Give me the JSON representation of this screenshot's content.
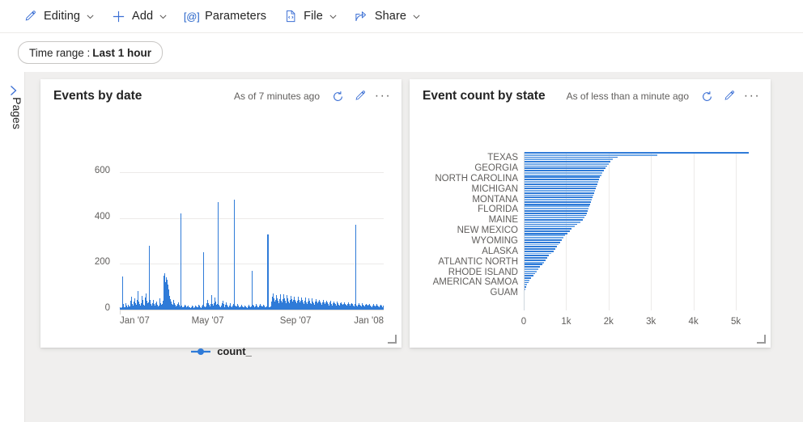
{
  "toolbar": {
    "items": [
      {
        "label": "Editing",
        "icon": "pencil-icon",
        "chevron": true
      },
      {
        "label": "Add",
        "icon": "plus-icon",
        "chevron": true
      },
      {
        "label": "Parameters",
        "icon": "at-bracket-icon",
        "chevron": false
      },
      {
        "label": "File",
        "icon": "code-file-icon",
        "chevron": true
      },
      {
        "label": "Share",
        "icon": "share-icon",
        "chevron": true
      }
    ]
  },
  "filters": {
    "time_range_prefix": "Time range : ",
    "time_range_value": "Last 1 hour"
  },
  "rail": {
    "label": "Pages",
    "expand_icon": "chevron-right-icon"
  },
  "cards": [
    {
      "title": "Events by date",
      "as_of": "As of 7 minutes ago",
      "refresh_icon": "refresh-icon",
      "edit_icon": "pencil-icon",
      "more_icon": "ellipsis-icon"
    },
    {
      "title": "Event count by state",
      "as_of": "As of less than a minute ago",
      "refresh_icon": "refresh-icon",
      "edit_icon": "pencil-icon",
      "more_icon": "ellipsis-icon"
    }
  ],
  "chart_data": [
    {
      "type": "bar",
      "title": "Events by date",
      "xlabel": "",
      "ylabel": "",
      "ylim": [
        0,
        660
      ],
      "yticks": [
        0,
        200,
        400,
        600
      ],
      "ytick_labels": [
        "0",
        "200",
        "400",
        "600"
      ],
      "xtick_labels": [
        "Jan '07",
        "May '07",
        "Sep '07",
        "Jan '08"
      ],
      "xtick_positions": [
        0,
        0.333,
        0.666,
        1.0
      ],
      "grid": "horizontal",
      "legend": [
        "count_"
      ],
      "legend_position": "bottom",
      "series_color": "#2f7bd8",
      "x": "date (daily, Jan 2007 - Jan 2008)",
      "values": [
        12,
        8,
        10,
        145,
        24,
        18,
        12,
        9,
        30,
        16,
        11,
        22,
        14,
        9,
        13,
        40,
        55,
        26,
        18,
        34,
        48,
        30,
        22,
        17,
        44,
        80,
        36,
        25,
        19,
        28,
        60,
        42,
        30,
        20,
        16,
        52,
        70,
        38,
        27,
        21,
        33,
        280,
        44,
        26,
        18,
        30,
        41,
        24,
        16,
        12,
        27,
        36,
        22,
        14,
        19,
        48,
        30,
        21,
        13,
        25,
        38,
        150,
        160,
        120,
        140,
        130,
        110,
        100,
        90,
        60,
        45,
        34,
        26,
        20,
        28,
        42,
        30,
        22,
        15,
        18,
        24,
        33,
        20,
        14,
        11,
        420,
        18,
        12,
        9,
        14,
        21,
        16,
        10,
        8,
        13,
        19,
        12,
        9,
        7,
        11,
        17,
        13,
        10,
        8,
        12,
        18,
        14,
        10,
        9,
        15,
        22,
        16,
        11,
        8,
        13,
        20,
        250,
        15,
        11,
        9,
        14,
        30,
        44,
        28,
        20,
        15,
        24,
        62,
        38,
        26,
        18,
        30,
        52,
        34,
        22,
        16,
        26,
        470,
        20,
        14,
        10,
        16,
        28,
        40,
        24,
        17,
        12,
        20,
        32,
        22,
        15,
        11,
        18,
        27,
        19,
        13,
        10,
        16,
        24,
        480,
        18,
        13,
        10,
        15,
        23,
        17,
        12,
        9,
        14,
        21,
        15,
        11,
        8,
        12,
        19,
        14,
        10,
        8,
        13,
        20,
        15,
        11,
        9,
        14,
        170,
        22,
        16,
        12,
        9,
        15,
        23,
        17,
        12,
        10,
        16,
        24,
        18,
        13,
        10,
        15,
        22,
        16,
        12,
        9,
        14,
        21,
        330,
        17,
        12,
        9,
        15,
        34,
        56,
        70,
        48,
        36,
        28,
        44,
        64,
        50,
        38,
        30,
        46,
        68,
        52,
        40,
        31,
        47,
        66,
        51,
        39,
        30,
        45,
        62,
        48,
        37,
        29,
        44,
        60,
        46,
        35,
        28,
        42,
        58,
        44,
        34,
        27,
        40,
        56,
        42,
        33,
        26,
        39,
        54,
        41,
        32,
        25,
        38,
        52,
        40,
        31,
        24,
        37,
        50,
        38,
        30,
        23,
        36,
        48,
        37,
        29,
        22,
        35,
        46,
        36,
        28,
        21,
        34,
        44,
        34,
        27,
        20,
        33,
        42,
        33,
        26,
        20,
        32,
        40,
        31,
        25,
        19,
        31,
        38,
        30,
        24,
        18,
        30,
        36,
        29,
        23,
        18,
        28,
        35,
        27,
        22,
        17,
        27,
        33,
        26,
        21,
        16,
        26,
        32,
        25,
        20,
        16,
        25,
        31,
        24,
        19,
        15,
        24,
        30,
        23,
        19,
        14,
        23,
        370,
        22,
        18,
        14,
        22,
        28,
        22,
        17,
        13,
        21,
        27,
        21,
        17,
        13,
        20,
        26,
        20,
        16,
        12,
        20,
        25,
        19,
        15,
        12,
        19,
        24,
        19,
        15,
        11,
        18,
        23,
        18,
        14,
        11,
        18,
        22,
        17,
        14,
        10,
        17
      ]
    },
    {
      "type": "bar",
      "orientation": "horizontal",
      "title": "Event count by state",
      "xlabel": "",
      "ylabel": "",
      "xlim": [
        0,
        5400
      ],
      "xticks": [
        0,
        1000,
        2000,
        3000,
        4000,
        5000
      ],
      "xtick_labels": [
        "0",
        "1k",
        "2k",
        "3k",
        "4k",
        "5k"
      ],
      "grid": "vertical",
      "bar_colors": [
        "#2f7bd8",
        "#6fa8e8"
      ],
      "visible_labels": [
        "TEXAS",
        "GEORGIA",
        "NORTH CAROLINA",
        "MICHIGAN",
        "MONTANA",
        "FLORIDA",
        "MAINE",
        "NEW MEXICO",
        "WYOMING",
        "ALASKA",
        "ATLANTIC NORTH",
        "RHODE ISLAND",
        "AMERICAN SAMOA",
        "GUAM"
      ],
      "values": [
        5300,
        3150,
        2220,
        2100,
        2050,
        2010,
        1970,
        1930,
        1890,
        1860,
        1830,
        1800,
        1780,
        1760,
        1740,
        1720,
        1700,
        1680,
        1660,
        1640,
        1620,
        1600,
        1580,
        1560,
        1540,
        1520,
        1500,
        1480,
        1460,
        1430,
        1400,
        1340,
        1250,
        1200,
        1130,
        1080,
        1030,
        980,
        940,
        900,
        860,
        820,
        780,
        740,
        700,
        650,
        600,
        560,
        520,
        470,
        430,
        390,
        340,
        300,
        260,
        220,
        180,
        140,
        110,
        80,
        55,
        40,
        25,
        12,
        5
      ]
    }
  ]
}
